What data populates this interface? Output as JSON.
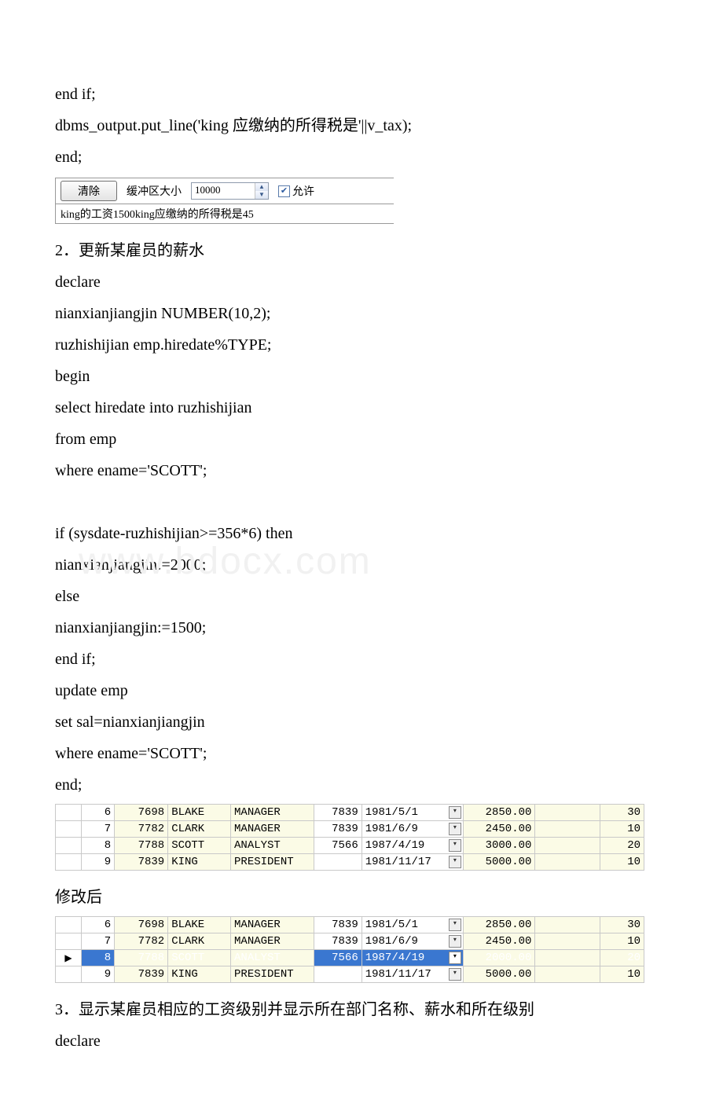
{
  "lines_top": [
    " end if;",
    " dbms_output.put_line('king 应缴纳的所得税是'||v_tax);",
    "end;"
  ],
  "shot1": {
    "clear_btn": "清除",
    "buffer_label": "缓冲区大小",
    "buffer_value": "10000",
    "allow_label": "允许",
    "output_line": "king的工资1500king应缴纳的所得税是45"
  },
  "section2_heading": "2．更新某雇员的薪水",
  "lines_block2a": [
    "declare",
    " nianxianjiangjin NUMBER(10,2);",
    " ruzhishijian emp.hiredate%TYPE;",
    "begin",
    " select hiredate into ruzhishijian",
    " from emp",
    " where ename='SCOTT';",
    "",
    " if (sysdate-ruzhishijian>=356*6) then"
  ],
  "watermark_text": "www.bdocx.com",
  "lines_block2b": [
    " nianxianjiangjin:=2000;",
    " else",
    " nianxianjiangjin:=1500;",
    " end if;",
    " update emp",
    " set sal=nianxianjiangjin",
    " where ename='SCOTT';",
    "end;"
  ],
  "table1_rows": [
    {
      "ptr": "",
      "rownum": "6",
      "empno": "7698",
      "ename": "BLAKE",
      "job": "MANAGER",
      "mgr": "7839",
      "hiredate": "1981/5/1",
      "sal": "2850.00",
      "comm": "",
      "deptno": "30"
    },
    {
      "ptr": "",
      "rownum": "7",
      "empno": "7782",
      "ename": "CLARK",
      "job": "MANAGER",
      "mgr": "7839",
      "hiredate": "1981/6/9",
      "sal": "2450.00",
      "comm": "",
      "deptno": "10"
    },
    {
      "ptr": "",
      "rownum": "8",
      "empno": "7788",
      "ename": "SCOTT",
      "job": "ANALYST",
      "mgr": "7566",
      "hiredate": "1987/4/19",
      "sal": "3000.00",
      "comm": "",
      "deptno": "20"
    },
    {
      "ptr": "",
      "rownum": "9",
      "empno": "7839",
      "ename": "KING",
      "job": "PRESIDENT",
      "mgr": "",
      "hiredate": "1981/11/17",
      "sal": "5000.00",
      "comm": "",
      "deptno": "10"
    }
  ],
  "after_edit_label": "修改后",
  "table2_rows": [
    {
      "ptr": "",
      "rownum": "6",
      "empno": "7698",
      "ename": "BLAKE",
      "job": "MANAGER",
      "mgr": "7839",
      "hiredate": "1981/5/1",
      "sal": "2850.00",
      "comm": "",
      "deptno": "30",
      "sel": false
    },
    {
      "ptr": "",
      "rownum": "7",
      "empno": "7782",
      "ename": "CLARK",
      "job": "MANAGER",
      "mgr": "7839",
      "hiredate": "1981/6/9",
      "sal": "2450.00",
      "comm": "",
      "deptno": "10",
      "sel": false
    },
    {
      "ptr": "▶",
      "rownum": "8",
      "empno": "7788",
      "ename": "SCOTT",
      "job": "ANALYST",
      "mgr": "7566",
      "hiredate": "1987/4/19",
      "sal": "2000.00",
      "comm": "",
      "deptno": "20",
      "sel": true
    },
    {
      "ptr": "",
      "rownum": "9",
      "empno": "7839",
      "ename": "KING",
      "job": "PRESIDENT",
      "mgr": "",
      "hiredate": "1981/11/17",
      "sal": "5000.00",
      "comm": "",
      "deptno": "10",
      "sel": false
    }
  ],
  "section3_heading": "3．显示某雇员相应的工资级别并显示所在部门名称、薪水和所在级别",
  "lines_block3": [
    "declare"
  ]
}
